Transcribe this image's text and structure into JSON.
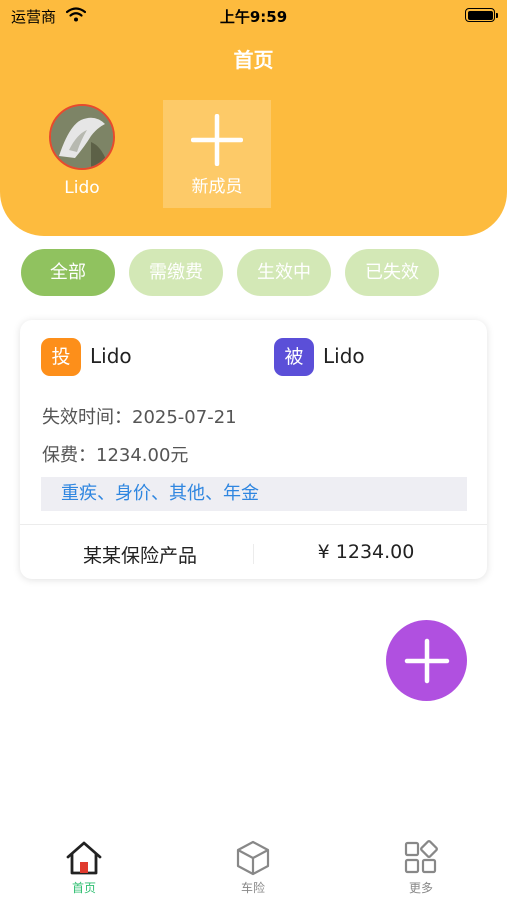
{
  "status_bar": {
    "carrier": "运营商",
    "time": "上午9:59"
  },
  "header": {
    "title": "首页",
    "members": [
      {
        "name": "Lido"
      }
    ],
    "add_member_label": "新成员"
  },
  "filters": [
    {
      "label": "全部",
      "active": true
    },
    {
      "label": "需缴费",
      "active": false
    },
    {
      "label": "生效中",
      "active": false
    },
    {
      "label": "已失效",
      "active": false
    }
  ],
  "policy": {
    "policyholder": {
      "badge": "投",
      "name": "Lido",
      "badge_color": "#fd8f1a"
    },
    "insured": {
      "badge": "被",
      "name": "Lido",
      "badge_color": "#5b4fd8"
    },
    "expiry_line": "失效时间：2025-07-21",
    "premium_line": "保费：1234.00元",
    "tags": "重疾、身价、其他、年金",
    "product_name": "某某保险产品",
    "price": "¥ 1234.00"
  },
  "fab": {
    "icon": "plus-icon",
    "color": "#b050e0"
  },
  "tabs": [
    {
      "label": "首页",
      "icon": "home-icon",
      "active": true
    },
    {
      "label": "车险",
      "icon": "cube-icon",
      "active": false
    },
    {
      "label": "更多",
      "icon": "grid-icon",
      "active": false
    }
  ],
  "colors": {
    "header": "#fdbb3e",
    "chip_active": "#90c25f",
    "chip_inactive": "#d3e8b6",
    "tab_active": "#2fbf71"
  }
}
